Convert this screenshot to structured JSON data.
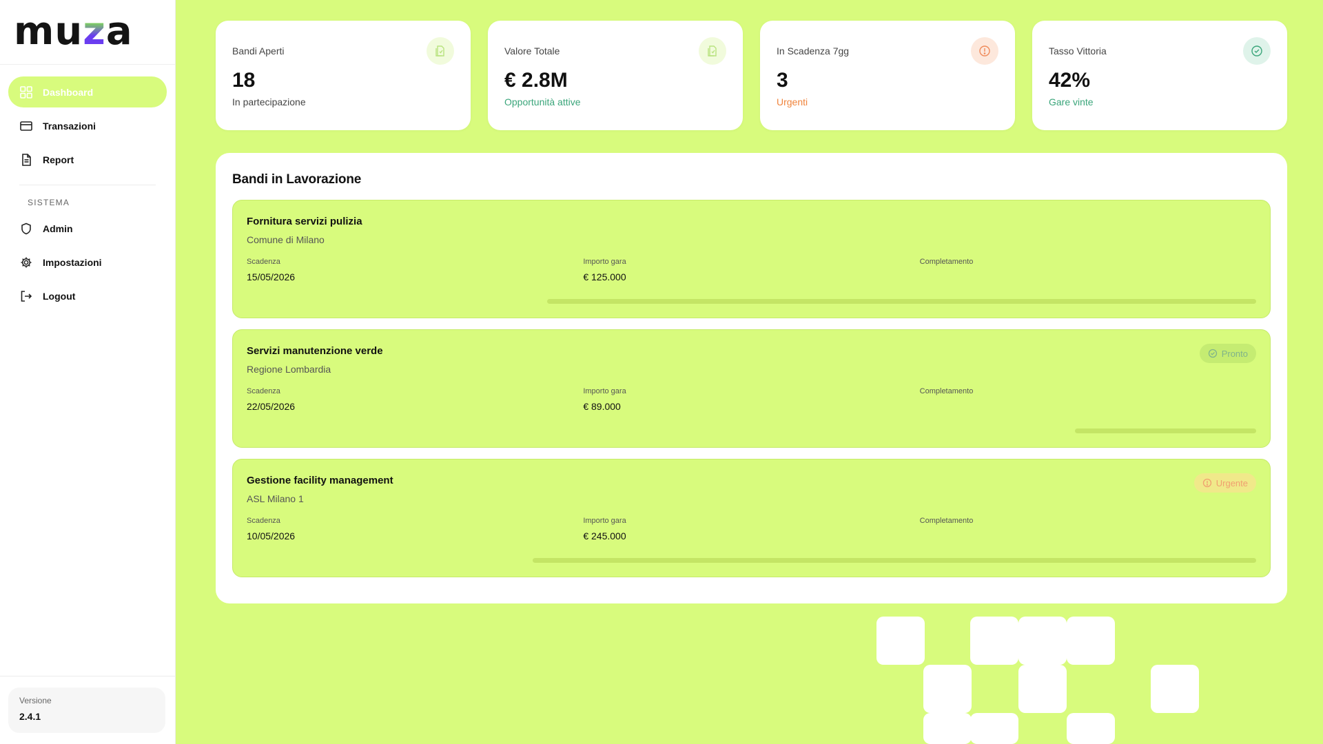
{
  "brand": {
    "logo_text": "muza"
  },
  "sidebar": {
    "items": [
      {
        "label": "Dashboard",
        "icon": "dashboard-icon",
        "active": true
      },
      {
        "label": "Transazioni",
        "icon": "card-icon"
      },
      {
        "label": "Report",
        "icon": "document-icon"
      }
    ],
    "section_label": "SISTEMA",
    "system_items": [
      {
        "label": "Admin",
        "icon": "shield-icon"
      },
      {
        "label": "Impostazioni",
        "icon": "gear-icon"
      },
      {
        "label": "Logout",
        "icon": "logout-icon"
      }
    ],
    "version_label": "Versione",
    "version_value": "2.4.1"
  },
  "stats": [
    {
      "label": "Bandi Aperti",
      "value": "18",
      "sub": "In partecipazione",
      "icon": "document-icon",
      "tone": "neutral"
    },
    {
      "label": "Valore Totale",
      "value": "€ 2.8M",
      "sub": "Opportunità attive",
      "icon": "document-icon",
      "tone": "green"
    },
    {
      "label": "In Scadenza 7gg",
      "value": "3",
      "sub": "Urgenti",
      "icon": "alert-icon",
      "tone": "orange"
    },
    {
      "label": "Tasso Vittoria",
      "value": "42%",
      "sub": "Gare vinte",
      "icon": "check-circle-icon",
      "tone": "green"
    }
  ],
  "panel": {
    "title": "Bandi in Lavorazione",
    "labels": {
      "deadline": "Scadenza",
      "amount": "Importo gara",
      "completion": "Completamento"
    },
    "tenders": [
      {
        "title": "Fornitura servizi pulizia",
        "org": "Comune di Milano",
        "deadline": "15/05/2026",
        "amount": "€ 125.000",
        "completion_fraction": 0.98,
        "badge": ""
      },
      {
        "title": "Servizi manutenzione verde",
        "org": "Regione Lombardia",
        "deadline": "22/05/2026",
        "amount": "€ 89.000",
        "completion_fraction": 0.25,
        "badge": "Pronto"
      },
      {
        "title": "Gestione facility management",
        "org": "ASL Milano 1",
        "deadline": "10/05/2026",
        "amount": "€ 245.000",
        "completion_fraction": 1.0,
        "badge": "Urgente"
      }
    ]
  },
  "colors": {
    "accent": "#d8fb7d",
    "green": "#3aa57a",
    "orange": "#f0843c",
    "purple": "#6a3df0"
  }
}
